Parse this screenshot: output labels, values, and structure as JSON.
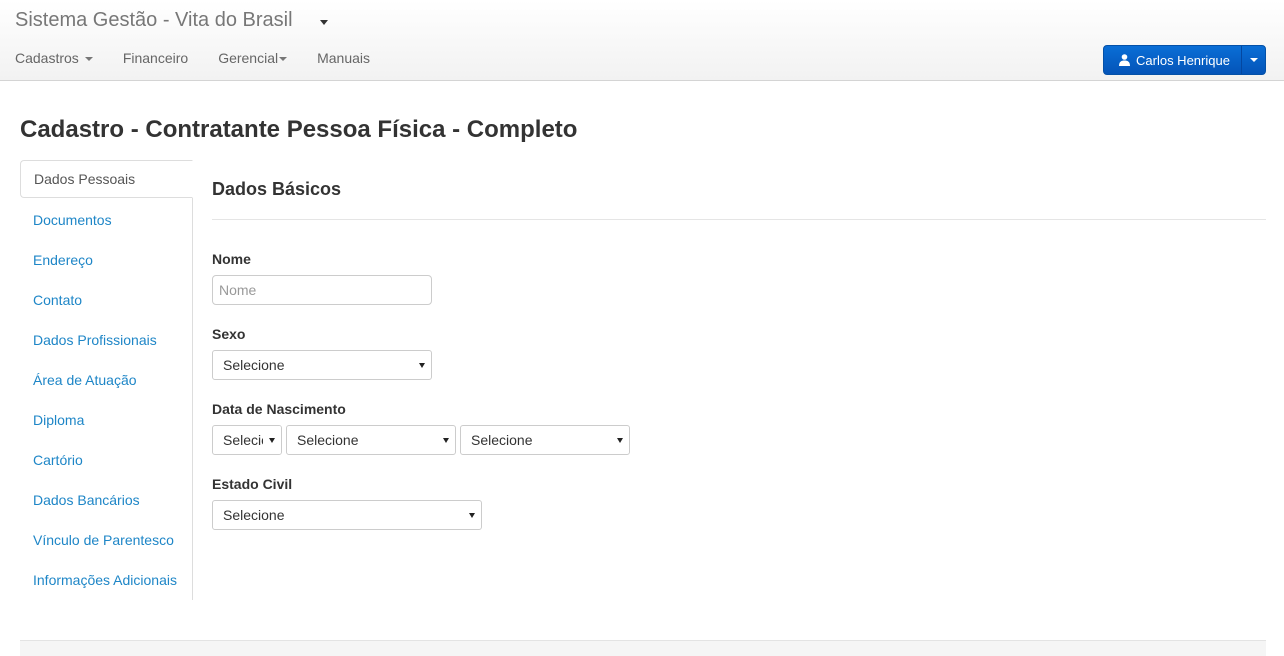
{
  "app": {
    "brand": "Sistema Gestão - Vita do Brasil"
  },
  "menu": [
    {
      "label": "Cadastros",
      "has_caret": true
    },
    {
      "label": "Financeiro",
      "has_caret": false
    },
    {
      "label": "Gerencial",
      "has_caret": true
    },
    {
      "label": "Manuais",
      "has_caret": false
    }
  ],
  "user": {
    "name": "Carlos Henrique",
    "icon": "user-icon"
  },
  "page": {
    "title": "Cadastro - Contratante Pessoa Física - Completo"
  },
  "sidenav": [
    {
      "label": "Dados Pessoais",
      "active": true
    },
    {
      "label": "Documentos"
    },
    {
      "label": "Endereço"
    },
    {
      "label": "Contato"
    },
    {
      "label": "Dados Profissionais"
    },
    {
      "label": "Área de Atuação"
    },
    {
      "label": "Diploma"
    },
    {
      "label": "Cartório"
    },
    {
      "label": "Dados Bancários"
    },
    {
      "label": "Vínculo de Parentesco"
    },
    {
      "label": "Informações Adicionais"
    }
  ],
  "form": {
    "section_title": "Dados Básicos",
    "nome": {
      "label": "Nome",
      "placeholder": "Nome",
      "value": ""
    },
    "sexo": {
      "label": "Sexo",
      "selected": "Selecione"
    },
    "nascimento": {
      "label": "Data de Nascimento",
      "dia": "Selecione",
      "mes": "Selecione",
      "ano": "Selecione"
    },
    "estado_civil": {
      "label": "Estado Civil",
      "selected": "Selecione"
    }
  },
  "colors": {
    "link": "#1e86c7",
    "primary_button": "#0a6ed6"
  }
}
